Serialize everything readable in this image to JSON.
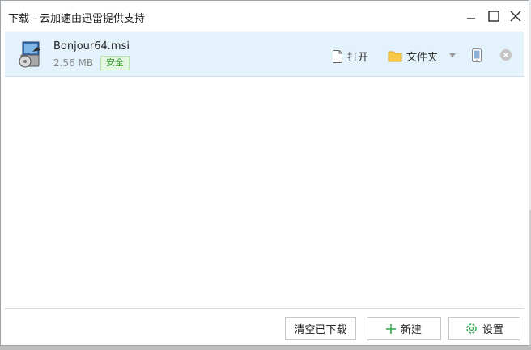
{
  "window": {
    "title": "下载 - 云加速由迅雷提供支持"
  },
  "download_item": {
    "file_name": "Bonjour64.msi",
    "file_size": "2.56 MB",
    "safe_label": "安全",
    "open_label": "打开",
    "folder_label": "文件夹"
  },
  "footer": {
    "clear_label": "清空已下载",
    "new_label": "新建",
    "settings_label": "设置"
  },
  "colors": {
    "row_highlight": "#e4f2fb",
    "safe_text": "#34a033",
    "plus": "#3aa655"
  }
}
